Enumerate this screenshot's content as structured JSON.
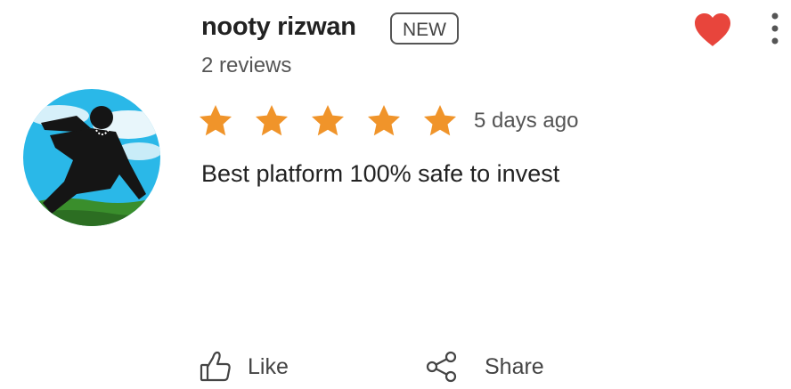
{
  "reviewer": {
    "name": "nooty rizwan",
    "badge": "NEW",
    "reviews_count": "2 reviews"
  },
  "review": {
    "rating": 5,
    "max_rating": 5,
    "time_ago": "5 days ago",
    "text": "Best platform 100% safe to invest"
  },
  "actions": {
    "like_label": "Like",
    "share_label": "Share"
  },
  "icons": {
    "favorite": "heart-icon",
    "overflow": "more-vertical-icon",
    "like": "thumbs-up-icon",
    "share": "share-icon",
    "rating": "star-icon"
  },
  "colors": {
    "heart": "#e8453c",
    "star": "#f0942a",
    "text_primary": "#222222",
    "text_secondary": "#555555"
  }
}
